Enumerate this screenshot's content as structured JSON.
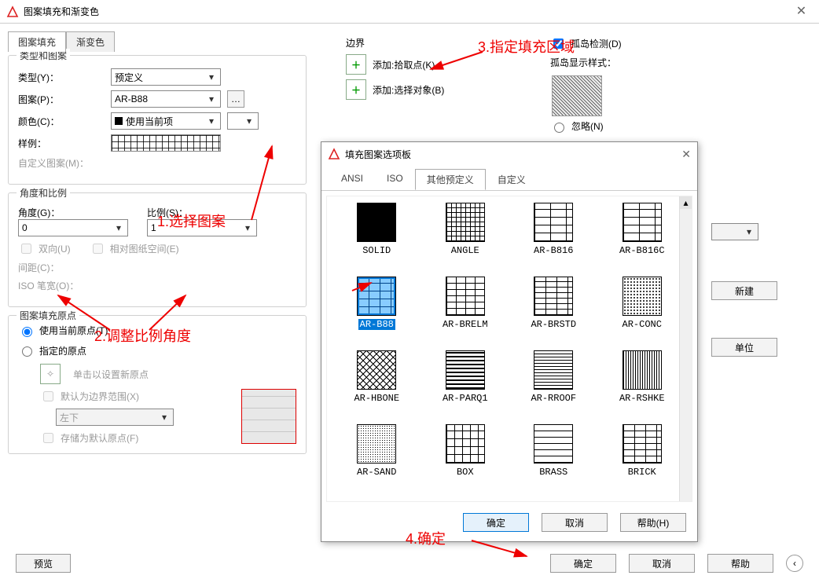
{
  "app": {
    "title": "图案填充和渐变色",
    "close_glyph": "✕"
  },
  "tabs": {
    "hatch": "图案填充",
    "gradient": "渐变色"
  },
  "type_pattern": {
    "legend": "类型和图案",
    "type_label": "类型(Y)：",
    "type_value": "预定义",
    "pattern_label": "图案(P)：",
    "pattern_value": "AR-B88",
    "color_label": "颜色(C)：",
    "color_value": "使用当前项",
    "sample_label": "样例：",
    "custom_label": "自定义图案(M)："
  },
  "angle_scale": {
    "legend": "角度和比例",
    "angle_label": "角度(G)：",
    "angle_value": "0",
    "scale_label": "比例(S)：",
    "scale_value": "1",
    "bidir": "双向(U)",
    "paper": "相对图纸空间(E)",
    "gap_label": "间距(C)：",
    "iso_label": "ISO 笔宽(O)："
  },
  "origin": {
    "legend": "图案填充原点",
    "use_current": "使用当前原点(T)",
    "specify": "指定的原点",
    "click_set": "单击以设置新原点",
    "default_extent": "默认为边界范围(X)",
    "anchor_value": "左下",
    "store_default": "存储为默认原点(F)"
  },
  "boundary": {
    "legend": "边界",
    "add_pick": "添加:拾取点(K)",
    "add_select": "添加:选择对象(B)"
  },
  "islands": {
    "detect": "孤岛检测(D)",
    "style_label": "孤岛显示样式：",
    "ignore": "忽略(N)"
  },
  "right_btns": {
    "new": "新建",
    "unit": "单位"
  },
  "bottom": {
    "preview": "预览",
    "ok": "确定",
    "cancel": "取消",
    "help": "帮助"
  },
  "popup": {
    "title": "填充图案选项板",
    "tabs": {
      "ansi": "ANSI",
      "iso": "ISO",
      "other": "其他预定义",
      "custom": "自定义"
    },
    "patterns": [
      "SOLID",
      "ANGLE",
      "AR-B816",
      "AR-B816C",
      "AR-B88",
      "AR-BRELM",
      "AR-BRSTD",
      "AR-CONC",
      "AR-HBONE",
      "AR-PARQ1",
      "AR-RROOF",
      "AR-RSHKE",
      "AR-SAND",
      "BOX",
      "BRASS",
      "BRICK"
    ],
    "selected": "AR-B88",
    "ok": "确定",
    "cancel": "取消",
    "help": "帮助(H)"
  },
  "annotations": {
    "a1": "1.选择图案",
    "a2": "2.调整比例角度",
    "a3": "3.指定填充区域",
    "a4": "4.确定"
  }
}
